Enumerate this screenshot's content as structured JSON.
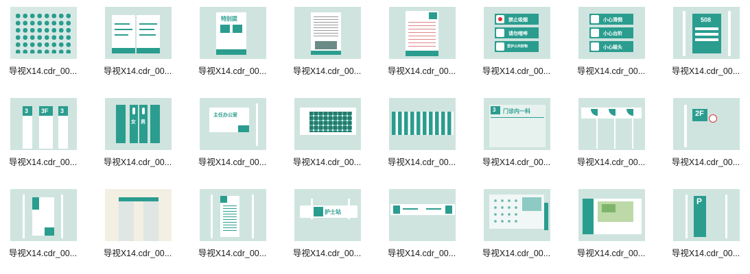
{
  "files": [
    {
      "name": "导视X14.cdr_00...",
      "kind": "icon-grid"
    },
    {
      "name": "导视X14.cdr_00...",
      "kind": "brochure"
    },
    {
      "name": "导视X14.cdr_00...",
      "kind": "poster-a"
    },
    {
      "name": "导视X14.cdr_00...",
      "kind": "poster-b"
    },
    {
      "name": "导视X14.cdr_00...",
      "kind": "flyer"
    },
    {
      "name": "导视X14.cdr_00...",
      "kind": "tags-red"
    },
    {
      "name": "导视X14.cdr_00...",
      "kind": "tags-people"
    },
    {
      "name": "导视X14.cdr_00...",
      "kind": "room-number"
    },
    {
      "name": "导视X14.cdr_00...",
      "kind": "pillars-3"
    },
    {
      "name": "导视X14.cdr_00...",
      "kind": "restroom"
    },
    {
      "name": "导视X14.cdr_00...",
      "kind": "office-sign"
    },
    {
      "name": "导视X14.cdr_00...",
      "kind": "board-grid"
    },
    {
      "name": "导视X14.cdr_00...",
      "kind": "board-grid-dark"
    },
    {
      "name": "导视X14.cdr_00...",
      "kind": "clinic-board"
    },
    {
      "name": "导视X14.cdr_00...",
      "kind": "banners"
    },
    {
      "name": "导视X14.cdr_00...",
      "kind": "floor-2f"
    },
    {
      "name": "导视X14.cdr_00...",
      "kind": "standee"
    },
    {
      "name": "导视X14.cdr_00...",
      "kind": "doorway"
    },
    {
      "name": "导视X14.cdr_00...",
      "kind": "directory"
    },
    {
      "name": "导视X14.cdr_00...",
      "kind": "nurse-station"
    },
    {
      "name": "导视X14.cdr_00...",
      "kind": "corridor"
    },
    {
      "name": "导视X14.cdr_00...",
      "kind": "wall-display"
    },
    {
      "name": "导视X14.cdr_00...",
      "kind": "map-board"
    },
    {
      "name": "导视X14.cdr_00...",
      "kind": "parking"
    }
  ],
  "signs": {
    "poster_a_title": "特别提",
    "tags_red": [
      "禁止吸烟",
      "请勿喧哗",
      "爱护公共财物"
    ],
    "tags_people": [
      "小心滑倒",
      "小心台阶",
      "小心碰头"
    ],
    "room_number": "508",
    "pillar_numbers": [
      "3",
      "3F",
      "3"
    ],
    "restroom": [
      "女",
      "男"
    ],
    "office_title": "主任办公室",
    "clinic_title": "门诊内一科",
    "clinic_floor": "3",
    "floor_2f": "2F",
    "nurse_station": "护士站",
    "parking": "P"
  }
}
